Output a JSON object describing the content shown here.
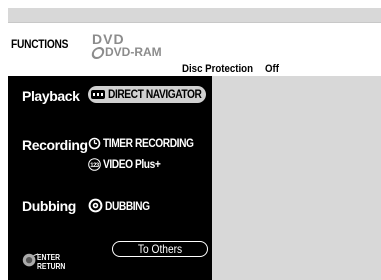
{
  "header": {
    "title": "FUNCTIONS",
    "logo_line1": "DVD",
    "logo_line2": "DVD-RAM",
    "disc_protection_label": "Disc Protection",
    "disc_protection_value": "Off"
  },
  "menu": {
    "categories": [
      {
        "label": "Playback",
        "items": [
          {
            "label": "DIRECT NAVIGATOR",
            "icon": "direct-navigator-icon",
            "selected": true
          }
        ]
      },
      {
        "label": "Recording",
        "items": [
          {
            "label": "TIMER RECORDING",
            "icon": "clock-icon"
          },
          {
            "label": "VIDEO Plus+",
            "icon": "video-plus-icon"
          }
        ]
      },
      {
        "label": "Dubbing",
        "items": [
          {
            "label": "DUBBING",
            "icon": "disc-icon"
          }
        ]
      }
    ],
    "others_button": "To Others",
    "enter_label": "ENTER",
    "return_label": "RETURN"
  },
  "colors": {
    "sidebar_bg": "#000000",
    "screen_bg": "#d8d8d8",
    "highlight_pill": "#d0d0d0",
    "logo_gray": "#8c8c8c"
  }
}
